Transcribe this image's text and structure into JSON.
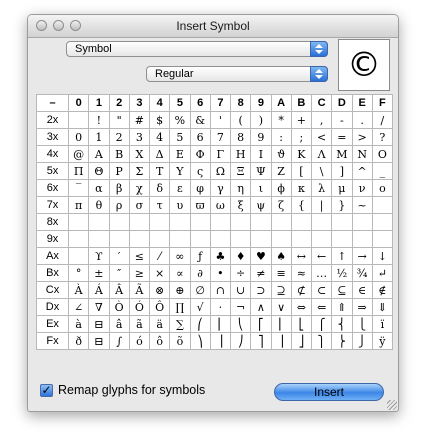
{
  "window": {
    "title": "Insert Symbol"
  },
  "font_popup": {
    "value": "Symbol"
  },
  "style_popup": {
    "value": "Regular"
  },
  "preview": {
    "glyph": "©"
  },
  "grid": {
    "corner": "–",
    "columns": [
      "0",
      "1",
      "2",
      "3",
      "4",
      "5",
      "6",
      "7",
      "8",
      "9",
      "A",
      "B",
      "C",
      "D",
      "E",
      "F"
    ],
    "rows": [
      {
        "label": "2x",
        "cells": [
          " ",
          "!",
          "\"",
          "#",
          "$",
          "%",
          "&",
          "'",
          "(",
          ")",
          "*",
          "+",
          ",",
          "-",
          ".",
          "/"
        ]
      },
      {
        "label": "3x",
        "cells": [
          "0",
          "1",
          "2",
          "3",
          "4",
          "5",
          "6",
          "7",
          "8",
          "9",
          ":",
          ";",
          "<",
          "=",
          ">",
          "?"
        ]
      },
      {
        "label": "4x",
        "cells": [
          "@",
          "A",
          "B",
          "X",
          "Δ",
          "E",
          "Φ",
          "Γ",
          "H",
          "I",
          "ϑ",
          "K",
          "Λ",
          "M",
          "N",
          "O"
        ]
      },
      {
        "label": "5x",
        "cells": [
          "Π",
          "Θ",
          "P",
          "Σ",
          "T",
          "Y",
          "ς",
          "Ω",
          "Ξ",
          "Ψ",
          "Z",
          "[",
          "\\",
          "]",
          "^",
          "_"
        ]
      },
      {
        "label": "6x",
        "cells": [
          "‾",
          "α",
          "β",
          "χ",
          "δ",
          "ε",
          "φ",
          "γ",
          "η",
          "ι",
          "ϕ",
          "κ",
          "λ",
          "μ",
          "ν",
          "o"
        ]
      },
      {
        "label": "7x",
        "cells": [
          "π",
          "θ",
          "ρ",
          "σ",
          "τ",
          "υ",
          "ϖ",
          "ω",
          "ξ",
          "ψ",
          "ζ",
          "{",
          "|",
          "}",
          "~",
          ""
        ]
      },
      {
        "label": "8x",
        "cells": [
          "",
          "",
          "",
          "",
          "",
          "",
          "",
          "",
          "",
          "",
          "",
          "",
          "",
          "",
          "",
          ""
        ]
      },
      {
        "label": "9x",
        "cells": [
          "",
          "",
          "",
          "",
          "",
          "",
          "",
          "",
          "",
          "",
          "",
          "",
          "",
          "",
          "",
          ""
        ]
      },
      {
        "label": "Ax",
        "cells": [
          "",
          "ϒ",
          "′",
          "≤",
          "⁄",
          "∞",
          "ƒ",
          "♣",
          "♦",
          "♥",
          "♠",
          "↔",
          "←",
          "↑",
          "→",
          "↓"
        ]
      },
      {
        "label": "Bx",
        "cells": [
          "°",
          "±",
          "″",
          "≥",
          "×",
          "∝",
          "∂",
          "•",
          "÷",
          "≠",
          "≡",
          "≈",
          "…",
          "½",
          "¾",
          "↵"
        ]
      },
      {
        "label": "Cx",
        "cells": [
          "À",
          "Á",
          "Â",
          "Ã",
          "⊗",
          "⊕",
          "∅",
          "∩",
          "∪",
          "⊃",
          "⊇",
          "⊄",
          "⊂",
          "⊆",
          "∈",
          "∉"
        ]
      },
      {
        "label": "Dx",
        "cells": [
          "∠",
          "∇",
          "Ò",
          "Ó",
          "Ô",
          "∏",
          "√",
          "⋅",
          "¬",
          "∧",
          "∨",
          "⇔",
          "⇐",
          "⇑",
          "⇒",
          "⇓"
        ]
      },
      {
        "label": "Ex",
        "cells": [
          "à",
          "⊟",
          "â",
          "ã",
          "ä",
          "∑",
          "⎛",
          "⎜",
          "⎝",
          "⎡",
          "⎢",
          "⎣",
          "⎧",
          "⎨",
          "⎩",
          "ï"
        ]
      },
      {
        "label": "Fx",
        "cells": [
          "ð",
          "⊟",
          "∫",
          "ó",
          "ô",
          "õ",
          "⎞",
          "⎟",
          "⎠",
          "⎤",
          "⎥",
          "⎦",
          "⎫",
          "⎬",
          "⎭",
          "ÿ"
        ]
      }
    ]
  },
  "remap_checkbox": {
    "label": "Remap glyphs for symbols",
    "checked": true,
    "mark": "✓"
  },
  "insert_button": {
    "label": "Insert"
  },
  "colors": {
    "accent": "#3c86e6",
    "window_bg": "#e8e8e8"
  }
}
